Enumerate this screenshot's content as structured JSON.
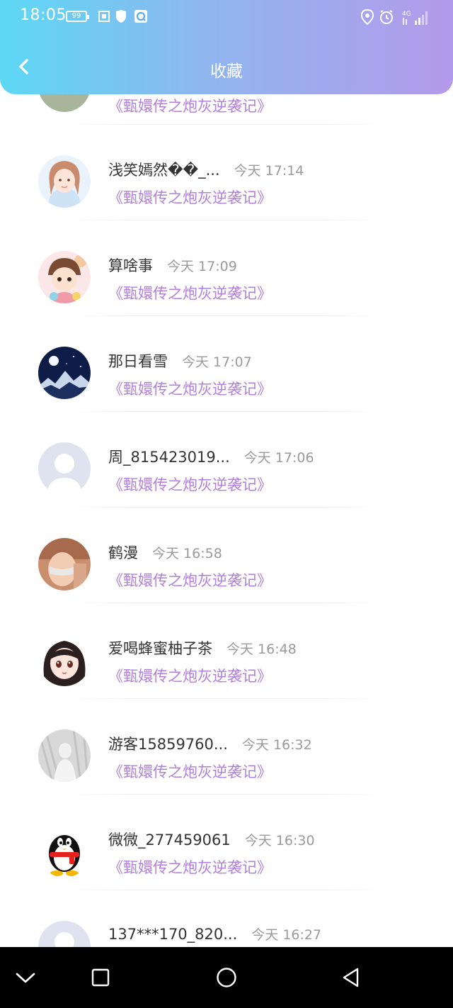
{
  "status_bar": {
    "time": "18:05",
    "battery": "99",
    "network": "4G",
    "icons": [
      "screenshot-icon",
      "shield-icon",
      "search-app-icon",
      "location-icon",
      "alarm-icon",
      "signal-icon"
    ]
  },
  "header": {
    "title": "收藏",
    "back_icon": "chevron-left-icon",
    "gradient": [
      "#5cd8f4",
      "#b49aea"
    ]
  },
  "accent_color": "#b07fdc",
  "list": {
    "items": [
      {
        "name": "",
        "time": "",
        "book": "《甄嬛传之炮灰逆袭记》",
        "avatar": "partial-avatar"
      },
      {
        "name": "浅笑嫣然��_...",
        "time": "今天 17:14",
        "book": "《甄嬛传之炮灰逆袭记》",
        "avatar": "girl-illustration"
      },
      {
        "name": "算啥事",
        "time": "今天 17:09",
        "book": "《甄嬛传之炮灰逆袭记》",
        "avatar": "boy-illustration"
      },
      {
        "name": "那日看雪",
        "time": "今天 17:07",
        "book": "《甄嬛传之炮灰逆袭记》",
        "avatar": "night-mountain"
      },
      {
        "name": "周_815423019...",
        "time": "今天 17:06",
        "book": "《甄嬛传之炮灰逆袭记》",
        "avatar": "default-user"
      },
      {
        "name": "鹤漫",
        "time": "今天 16:58",
        "book": "《甄嬛传之炮灰逆袭记》",
        "avatar": "photo-face"
      },
      {
        "name": "爱喝蜂蜜柚子茶",
        "time": "今天 16:48",
        "book": "《甄嬛传之炮灰逆袭记》",
        "avatar": "anime-girl"
      },
      {
        "name": "游客15859760...",
        "time": "今天 16:32",
        "book": "《甄嬛传之炮灰逆袭记》",
        "avatar": "grey-photo"
      },
      {
        "name": "微微_277459061",
        "time": "今天 16:30",
        "book": "《甄嬛传之炮灰逆袭记》",
        "avatar": "qq-penguin"
      },
      {
        "name": "137***170_820...",
        "time": "今天 16:27",
        "book": "",
        "avatar": "default-user"
      }
    ]
  },
  "system_nav": {
    "icons": [
      "collapse-icon",
      "recent-apps-icon",
      "home-icon",
      "back-icon"
    ]
  }
}
